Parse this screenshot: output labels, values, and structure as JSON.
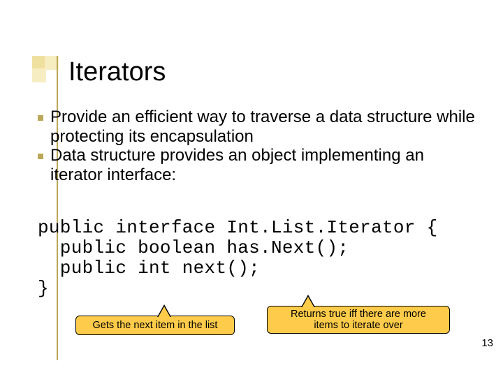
{
  "title": "Iterators",
  "bullets": [
    "Provide an efficient way to traverse a data structure while protecting its encapsulation",
    "Data structure provides an object implementing an iterator interface:"
  ],
  "code": "public interface Int.List.Iterator {\n  public boolean has.Next();\n  public int next();\n}",
  "callouts": {
    "next": "Gets the next item in the list",
    "hasNext": "Returns true iff there are more\nitems to iterate over"
  },
  "page": "13"
}
